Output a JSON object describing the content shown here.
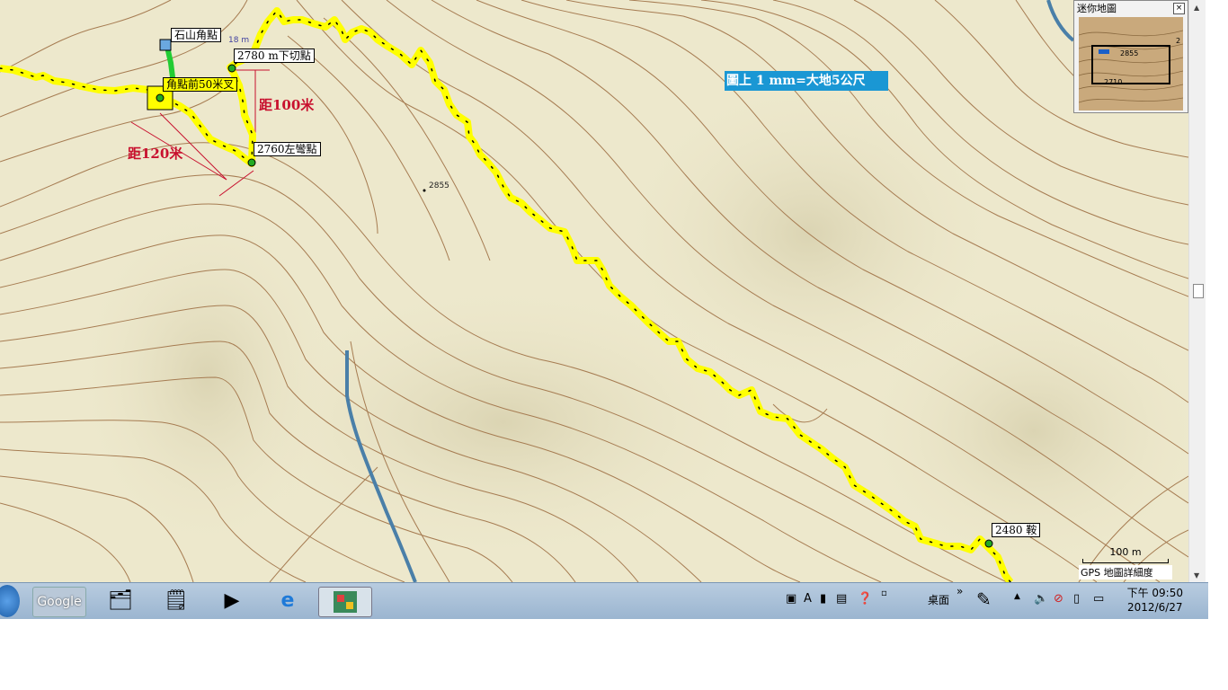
{
  "map": {
    "waypoints": [
      {
        "name": "石山角點",
        "style": "white"
      },
      {
        "name": "2780 m下切點",
        "style": "white"
      },
      {
        "name": "角點前50米叉",
        "style": "yellow"
      },
      {
        "name": "2760左彎點",
        "style": "white"
      },
      {
        "name": "2480 鞍",
        "style": "white"
      }
    ],
    "distance_labels": [
      "距100米",
      "距120米"
    ],
    "elevation_labels": [
      "2855",
      "18 m"
    ],
    "scale_banner": "圖上 1 mm=大地5公尺",
    "colors": {
      "track": "#ffff00",
      "route_segment": "#22cc33",
      "river": "#4a7fa8",
      "contour": "#a67c52",
      "terrain": "#ede8cc"
    }
  },
  "mini_map": {
    "title": "迷你地圖",
    "close": "×",
    "labels": [
      "2855",
      "2710",
      "2"
    ]
  },
  "scalebar": {
    "distance": "100 m",
    "detail_label": "GPS 地圖詳細度"
  },
  "taskbar": {
    "google": "Google",
    "desktop": "桌面",
    "chevron": "»",
    "time": "下午 09:50",
    "date": "2012/6/27"
  }
}
